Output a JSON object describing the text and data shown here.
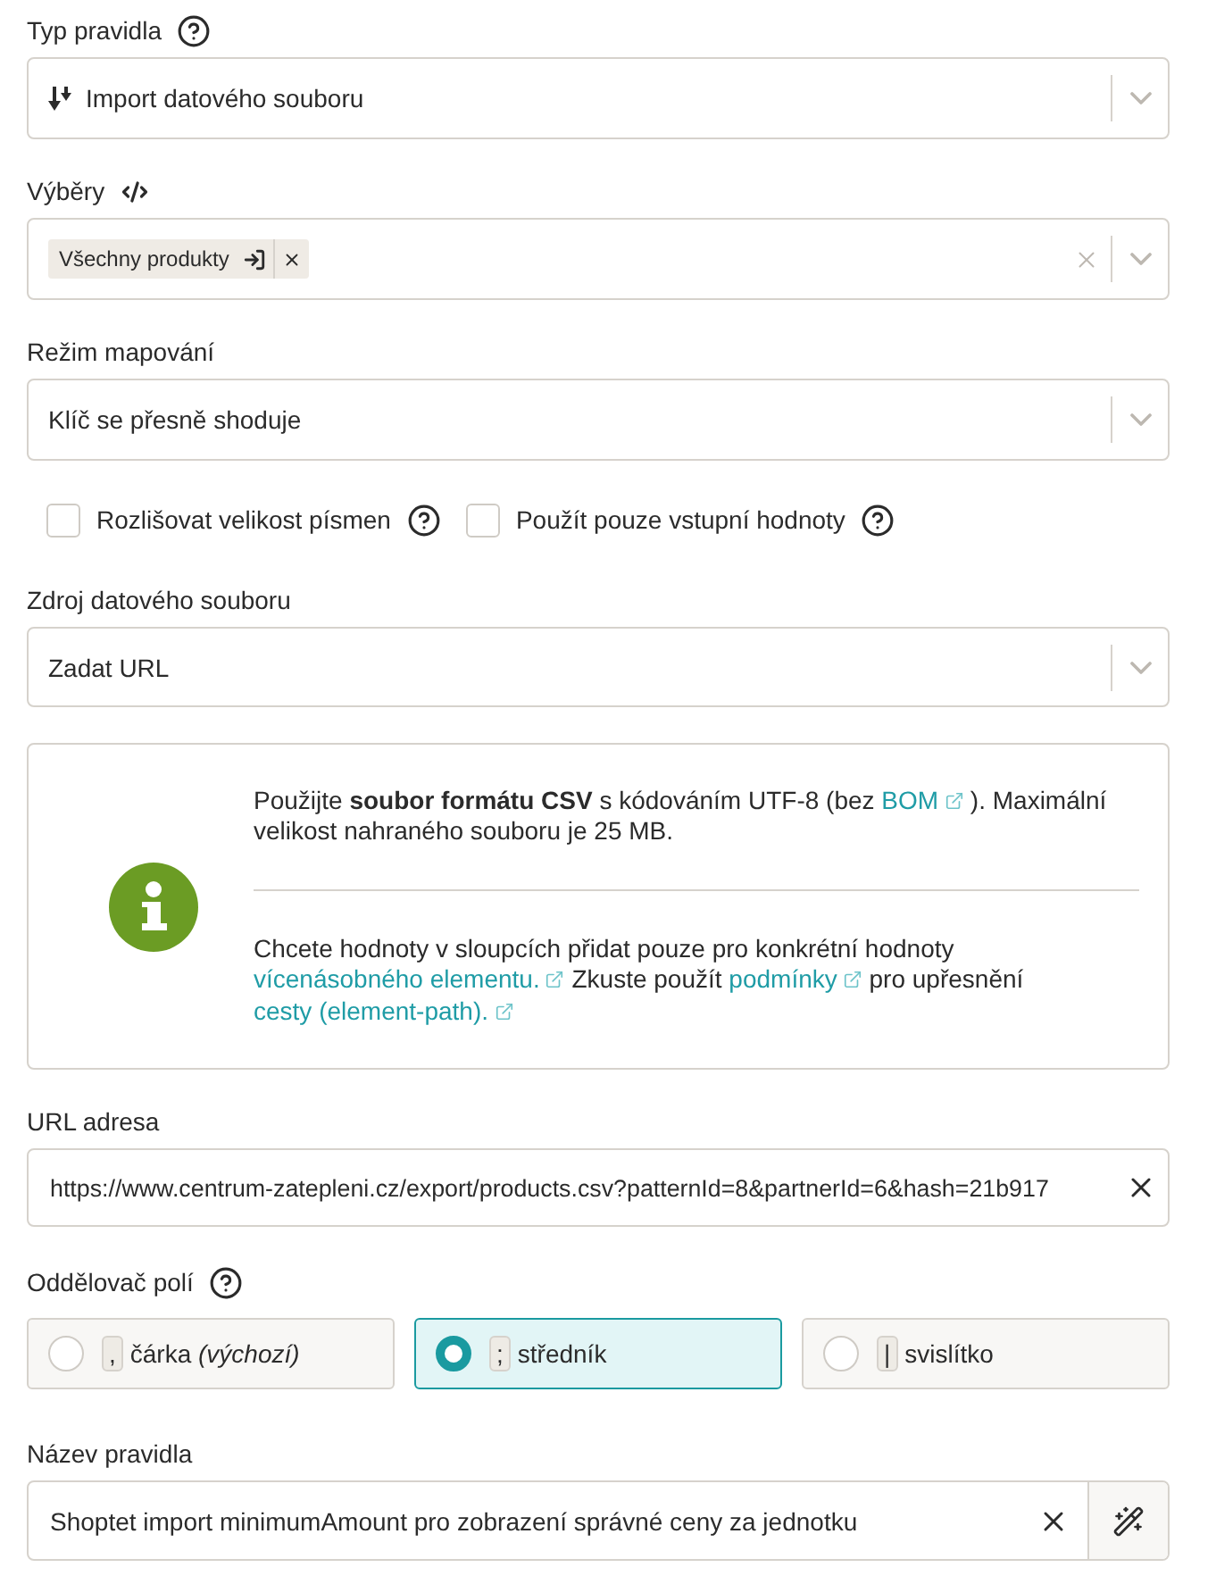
{
  "rule_type": {
    "label": "Typ pravidla",
    "value": "Import datového souboru"
  },
  "selections": {
    "label": "Výběry",
    "tags": [
      {
        "text": "Všechny produkty"
      }
    ]
  },
  "mapping_mode": {
    "label": "Režim mapování",
    "value": "Klíč se přesně shoduje"
  },
  "options": [
    {
      "label": "Rozlišovat velikost písmen",
      "checked": false
    },
    {
      "label": "Použít pouze vstupní hodnoty",
      "checked": false
    }
  ],
  "data_source": {
    "label": "Zdroj datového souboru",
    "value": "Zadat URL"
  },
  "info": {
    "paragraphs": [
      [
        {
          "kind": "text",
          "text": "Použijte **soubor formátu CSV** s kódováním UTF-8 (bez "
        },
        {
          "kind": "link",
          "text": "BOM"
        },
        {
          "kind": "text",
          "text": " ). Maximální velikost nahraného souboru je 25 MB."
        }
      ],
      [
        {
          "kind": "text",
          "text": "Chcete hodnoty v sloupcích přidat pouze pro konkrétní hodnoty "
        },
        {
          "kind": "link",
          "text": "vícenásobného elementu."
        },
        {
          "kind": "text",
          "text": " Zkuste použít "
        },
        {
          "kind": "link",
          "text": "podmínky"
        },
        {
          "kind": "text",
          "text": " pro upřesnění "
        },
        {
          "kind": "link",
          "text": "cesty (element-path)."
        }
      ]
    ]
  },
  "url": {
    "label": "URL adresa",
    "value": "https://www.centrum-zatepleni.cz/export/products.csv?patternId=8&partnerId=6&hash=21b917"
  },
  "field_separator": {
    "label": "Oddělovač polí",
    "options": [
      {
        "key": ",",
        "label": "čárka *(výchozí)*",
        "selected": false
      },
      {
        "key": ";",
        "label": "středník",
        "selected": true
      },
      {
        "key": "|",
        "label": "svislítko",
        "selected": false
      }
    ]
  },
  "rule_name": {
    "label": "Název pravidla",
    "value": "Shoptet import minimumAmount pro zobrazení správné ceny za jednotku"
  }
}
